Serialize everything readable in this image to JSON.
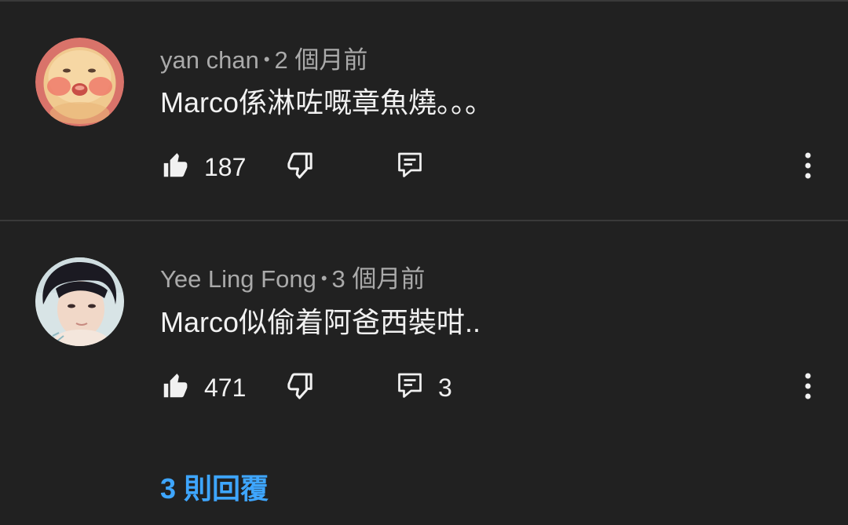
{
  "comments": [
    {
      "author": "yan chan",
      "time": "2 個月前",
      "text": "Marco係淋咗嘅章魚燒。。。",
      "likes": "187",
      "reply_count": "",
      "avatar": "cartoon-face-avatar"
    },
    {
      "author": "Yee Ling Fong",
      "time": "3 個月前",
      "text": "Marco似偷着阿爸西裝咁..",
      "likes": "471",
      "reply_count": "3",
      "avatar": "person-photo-avatar",
      "replies_link": "3 則回覆"
    }
  ],
  "meta_separator": "•",
  "colors": {
    "background": "#212121",
    "divider": "#3a3a3a",
    "primary_text": "#f1f1f1",
    "secondary_text": "#aaaaaa",
    "link": "#3ea6ff"
  },
  "icons": {
    "like": "thumbs-up-icon",
    "dislike": "thumbs-down-icon",
    "reply": "comment-reply-icon",
    "more": "more-vertical-icon"
  }
}
